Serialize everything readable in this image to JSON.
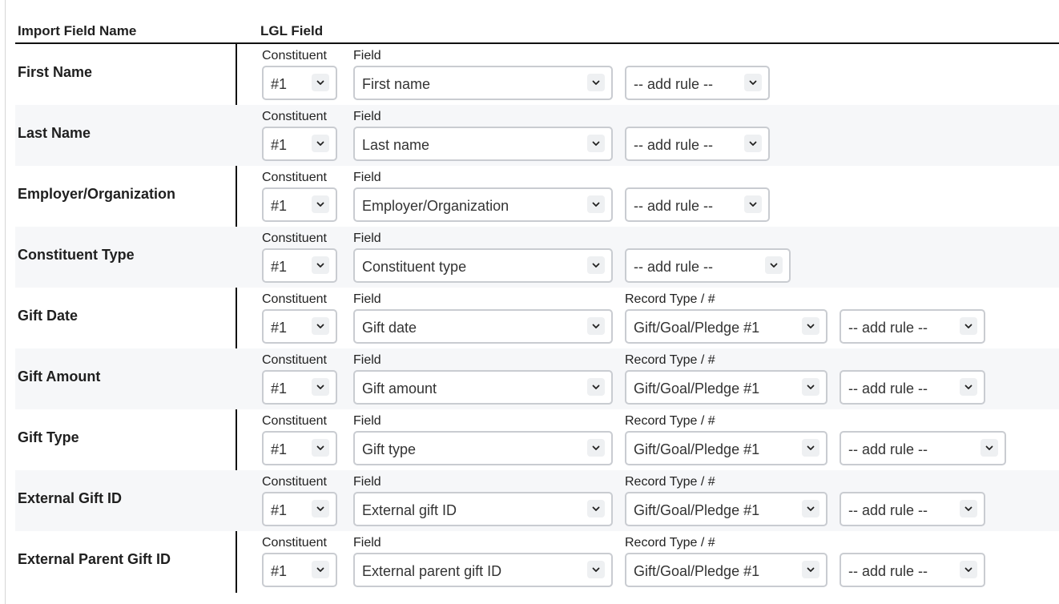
{
  "header": {
    "import_field_name": "Import Field Name",
    "lgl_field": "LGL Field"
  },
  "labels": {
    "constituent": "Constituent",
    "field": "Field",
    "record_type": "Record Type / #"
  },
  "icons": {
    "select_arrow": "chevron-down-icon"
  },
  "rows": [
    {
      "name": "First Name",
      "constituent": "#1",
      "field": "First name",
      "rule": "-- add rule --"
    },
    {
      "name": "Last Name",
      "constituent": "#1",
      "field": "Last name",
      "rule": "-- add rule --"
    },
    {
      "name": "Employer/Organization",
      "constituent": "#1",
      "field": "Employer/Organization",
      "rule": "-- add rule --"
    },
    {
      "name": "Constituent Type",
      "constituent": "#1",
      "field": "Constituent type",
      "rule": "-- add rule --"
    },
    {
      "name": "Gift Date",
      "constituent": "#1",
      "field": "Gift date",
      "record_type": "Gift/Goal/Pledge #1",
      "rule": "-- add rule --"
    },
    {
      "name": "Gift Amount",
      "constituent": "#1",
      "field": "Gift amount",
      "record_type": "Gift/Goal/Pledge #1",
      "rule": "-- add rule --"
    },
    {
      "name": "Gift Type",
      "constituent": "#1",
      "field": "Gift type",
      "record_type": "Gift/Goal/Pledge #1",
      "rule": "-- add rule --"
    },
    {
      "name": "External Gift ID",
      "constituent": "#1",
      "field": "External gift ID",
      "record_type": "Gift/Goal/Pledge #1",
      "rule": "-- add rule --"
    },
    {
      "name": "External Parent Gift ID",
      "constituent": "#1",
      "field": "External parent gift ID",
      "record_type": "Gift/Goal/Pledge #1",
      "rule": "-- add rule --"
    }
  ]
}
